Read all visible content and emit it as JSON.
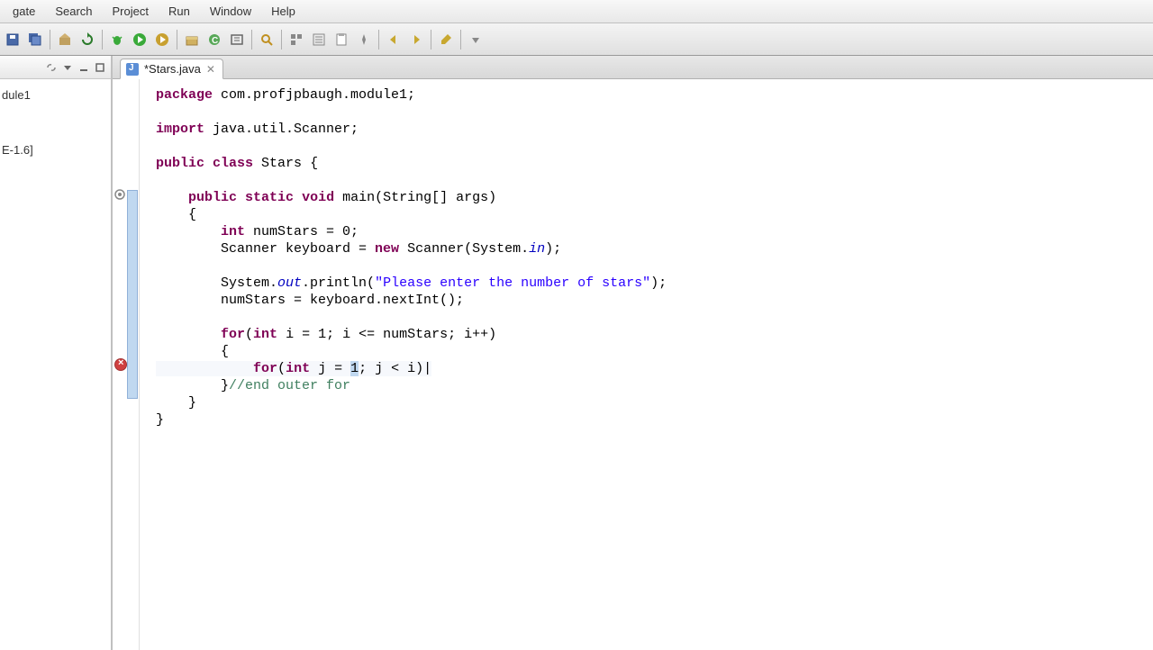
{
  "menu": {
    "items": [
      "gate",
      "Search",
      "Project",
      "Run",
      "Window",
      "Help"
    ]
  },
  "tree": {
    "item1": "dule1",
    "item2": "E-1.6]"
  },
  "tab": {
    "title": "*Stars.java"
  },
  "code": {
    "pkg_kw": "package",
    "pkg_name": " com.profjpbaugh.module1;",
    "import_kw": "import",
    "import_name": " java.util.Scanner;",
    "public": "public",
    "class": "class",
    "classname": " Stars ",
    "ob": "{",
    "static": "static",
    "void": "void",
    "main": " main(String[] args)",
    "lb": "    {",
    "varline_a": "        ",
    "int": "int",
    "varline_b": " numStars = 0;",
    "scanline_a": "        Scanner keyboard = ",
    "new": "new",
    "scanline_b": " Scanner(System.",
    "in": "in",
    "scanline_c": ");",
    "sysout_a": "        System.",
    "out": "out",
    "sysout_b": ".println(",
    "prompt": "\"Please enter the number of stars\"",
    "sysout_c": ");",
    "readline": "        numStars = keyboard.nextInt();",
    "for1_a": "        ",
    "for": "for",
    "for1_b": "(",
    "for1_c": " i = 1; i <= numStars; i++)",
    "for1_ob": "        {",
    "for2_a": "            ",
    "for2_b": "(",
    "for2_c": " j = ",
    "for2_sel": "1",
    "for2_d": "; j < i)",
    "for2_caret": "|",
    "endouter_a": "        }",
    "endouter_b": "//end outer for",
    "rb1": "    }",
    "rb2": "}"
  }
}
